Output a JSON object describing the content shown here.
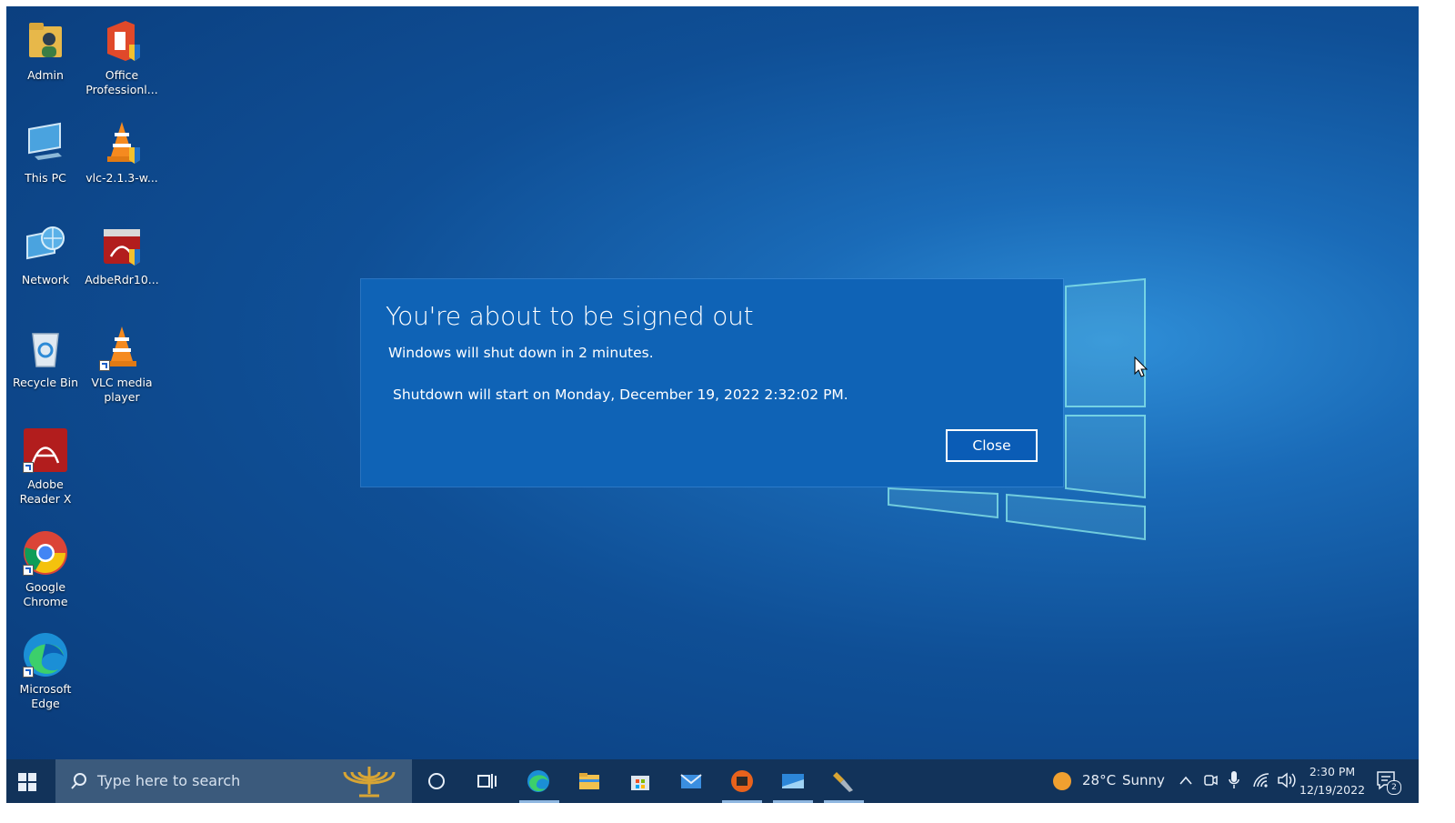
{
  "desktop": {
    "icons": [
      {
        "label": "Admin"
      },
      {
        "label": "Office Professionl..."
      },
      {
        "label": "This PC"
      },
      {
        "label": "vlc-2.1.3-w..."
      },
      {
        "label": "Network"
      },
      {
        "label": "AdbeRdr10..."
      },
      {
        "label": "Recycle Bin"
      },
      {
        "label": "VLC media player"
      },
      {
        "label": "Adobe Reader X"
      },
      {
        "label": "Google Chrome"
      },
      {
        "label": "Microsoft Edge"
      }
    ]
  },
  "dialog": {
    "title": "You're about to be signed out",
    "message": "Windows will shut down in 2 minutes.",
    "detail": "Shutdown will start on Monday, December 19, 2022 2:32:02 PM.",
    "close_label": "Close"
  },
  "taskbar": {
    "search_placeholder": "Type here to search",
    "weather_temp": "28°C",
    "weather_text": "Sunny",
    "clock_time": "2:30 PM",
    "clock_date": "12/19/2022",
    "notification_count": "2"
  },
  "colors": {
    "dialog_bg": "#0f63b6",
    "taskbar_bg": "#12335a",
    "desktop_accent": "#1a6bb8"
  }
}
